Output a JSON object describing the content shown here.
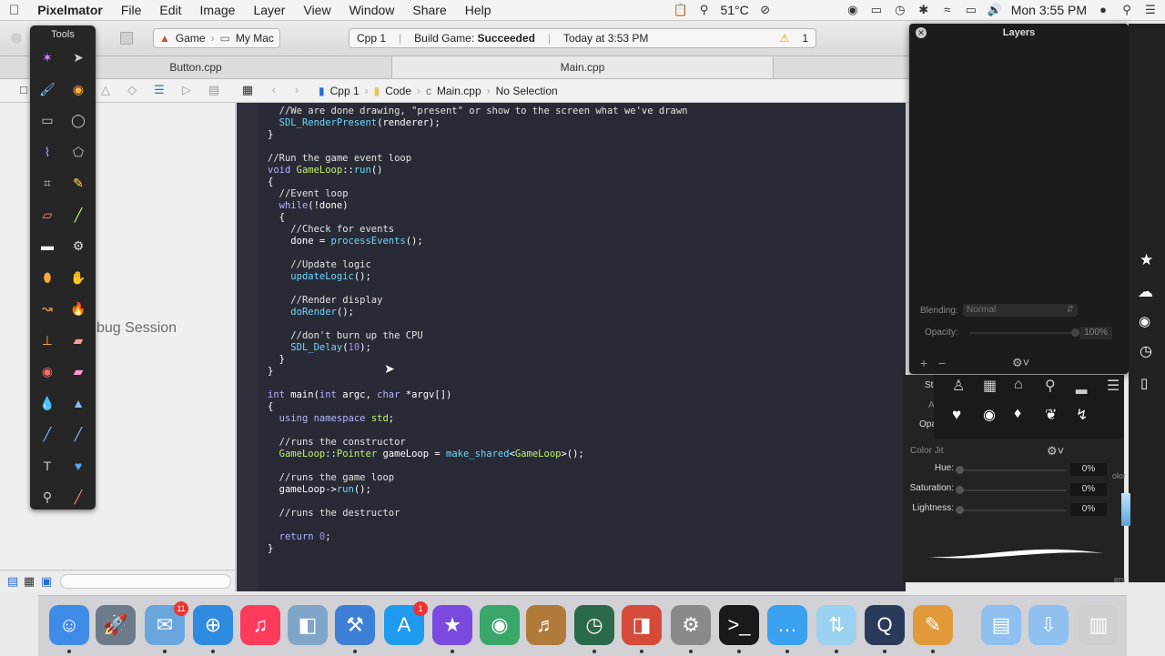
{
  "menubar": {
    "apple": "",
    "app_name": "Pixelmator",
    "items": [
      "File",
      "Edit",
      "Image",
      "Layer",
      "View",
      "Window",
      "Share",
      "Help"
    ],
    "temperature": "51°C",
    "clock": "Mon 3:55 PM"
  },
  "xcode": {
    "scheme": "Game",
    "destination": "My Mac",
    "activity": {
      "project": "Cpp 1",
      "status_prefix": "Build Game:",
      "status": "Succeeded",
      "time": "Today at 3:53 PM",
      "warnings": "1"
    },
    "tabs": [
      "Button.cpp",
      "Main.cpp"
    ],
    "breadcrumbs": [
      "Cpp 1",
      "Code",
      "Main.cpp",
      "No Selection"
    ],
    "navigator_partial_text": "bug Session",
    "code_lines": [
      "//We are done drawing, \"present\" or show to the screen what we've drawn",
      "SDL_RenderPresent(renderer);",
      "}",
      "",
      "//Run the game event loop",
      "void GameLoop::run()",
      "{",
      "//Event loop",
      "while(!done)",
      "{",
      "//Check for events",
      "done = processEvents();",
      "",
      "//Update logic",
      "updateLogic();",
      "",
      "//Render display",
      "doRender();",
      "",
      "//don't burn up the CPU",
      "SDL_Delay(10);",
      "}",
      "}",
      "",
      "int main(int argc, char *argv[])",
      "{",
      "using namespace std;",
      "",
      "//runs the constructor",
      "GameLoop::Pointer gameLoop = make_shared<GameLoop>();",
      "",
      "//runs the game loop",
      "gameLoop->run();",
      "",
      "//runs the destructor",
      "",
      "return 0;",
      "}"
    ]
  },
  "tools_panel": {
    "title": "Tools",
    "icons": [
      "magic-wand-icon",
      "arrow-icon",
      "paint-brush-icon",
      "color-picker-icon",
      "rect-select-icon",
      "ellipse-select-icon",
      "lasso-icon",
      "polygon-lasso-icon",
      "crop-icon",
      "pencil-icon",
      "eraser-icon",
      "line-icon",
      "rectangle-shape-icon",
      "settings-icon",
      "gradient-icon",
      "hand-icon",
      "smudge-icon",
      "burn-icon",
      "stamp-icon",
      "bandage-icon",
      "red-eye-icon",
      "eraser2-icon",
      "blur-icon",
      "sharpen-icon",
      "pen-icon",
      "pen-curve-icon",
      "text-icon",
      "heart-shape-icon",
      "zoom-icon",
      "eyedropper-icon"
    ]
  },
  "layers_panel": {
    "title": "Layers",
    "blending_label": "Blending:",
    "blending_value": "Normal",
    "opacity_label": "Opacity:",
    "opacity_value": "100%"
  },
  "brush_panel": {
    "stroke_label": "Strok",
    "angle_label": "Angl",
    "opacity_label": "Opacit",
    "color_jitter_label": "Color Jit",
    "hue_label": "Hue:",
    "hue_value": "0%",
    "saturation_label": "Saturation:",
    "saturation_value": "0%",
    "lightness_label": "Lightness:",
    "lightness_value": "0%",
    "partial_color_label": "olor",
    "partial_bottom_label": "ers"
  },
  "dock": {
    "apps": [
      "Finder",
      "Launchpad",
      "Mail",
      "Safari",
      "iTunes",
      "Preview",
      "Xcode",
      "App Store",
      "iMovie",
      "Photo Booth",
      "Logic",
      "Time Machine",
      "Parallels",
      "System Preferences",
      "Terminal",
      "Messages",
      "Transloader",
      "QuickTime",
      "Pixelmator",
      "Documents",
      "Downloads",
      "Trash"
    ],
    "mail_badge": "11",
    "appstore_badge": "1"
  }
}
